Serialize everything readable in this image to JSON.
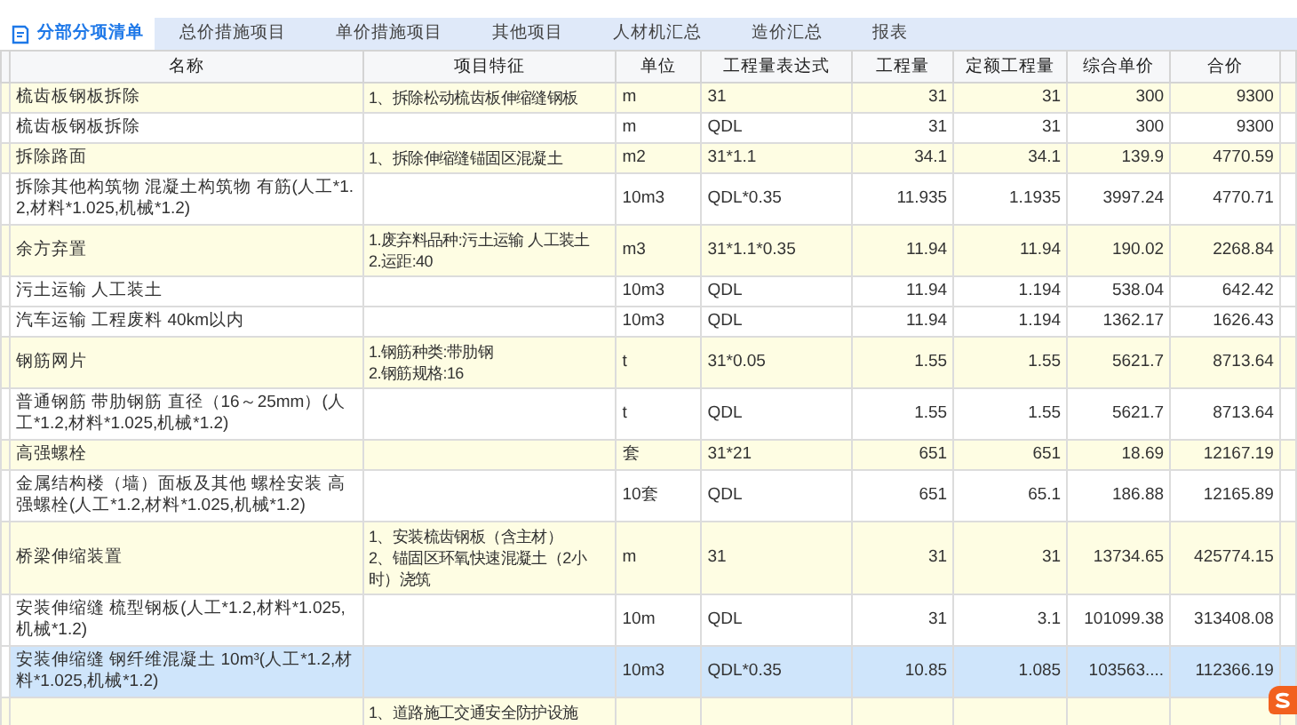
{
  "tabs": [
    {
      "label": "分部分项清单",
      "selected": true
    },
    {
      "label": "总价措施项目",
      "selected": false
    },
    {
      "label": "单价措施项目",
      "selected": false
    },
    {
      "label": "其他项目",
      "selected": false
    },
    {
      "label": "人材机汇总",
      "selected": false
    },
    {
      "label": "造价汇总",
      "selected": false
    },
    {
      "label": "报表",
      "selected": false
    }
  ],
  "table": {
    "columns": [
      "名称",
      "项目特征",
      "单位",
      "工程量表达式",
      "工程量",
      "定额工程量",
      "综合单价",
      "合价"
    ],
    "rows": [
      {
        "kind": "bill",
        "selected": false,
        "cells": [
          "梳齿板钢板拆除",
          "1、拆除松动梳齿板伸缩缝钢板",
          "m",
          "31",
          "31",
          "31",
          "300",
          "9300"
        ]
      },
      {
        "kind": "quota",
        "selected": false,
        "cells": [
          "梳齿板钢板拆除",
          "",
          "m",
          "QDL",
          "31",
          "31",
          "300",
          "9300"
        ]
      },
      {
        "kind": "bill",
        "selected": false,
        "cells": [
          "拆除路面",
          "1、拆除伸缩缝锚固区混凝土",
          "m2",
          "31*1.1",
          "34.1",
          "34.1",
          "139.9",
          "4770.59"
        ]
      },
      {
        "kind": "quota",
        "selected": false,
        "cells": [
          "拆除其他构筑物 混凝土构筑物 有筋(人工*1.2,材料*1.025,机械*1.2)",
          "",
          "10m3",
          "QDL*0.35",
          "11.935",
          "1.1935",
          "3997.24",
          "4770.71"
        ]
      },
      {
        "kind": "bill",
        "selected": false,
        "cells": [
          "余方弃置",
          "1.废弃料品种:污土运输 人工装土\n2.运距:40",
          "m3",
          "31*1.1*0.35",
          "11.94",
          "11.94",
          "190.02",
          "2268.84"
        ]
      },
      {
        "kind": "quota",
        "selected": false,
        "cells": [
          "污土运输 人工装土",
          "",
          "10m3",
          "QDL",
          "11.94",
          "1.194",
          "538.04",
          "642.42"
        ]
      },
      {
        "kind": "quota",
        "selected": false,
        "cells": [
          "汽车运输 工程废料 40km以内",
          "",
          "10m3",
          "QDL",
          "11.94",
          "1.194",
          "1362.17",
          "1626.43"
        ]
      },
      {
        "kind": "bill",
        "selected": false,
        "cells": [
          "钢筋网片",
          "1.钢筋种类:带肋钢\n2.钢筋规格:16",
          "t",
          "31*0.05",
          "1.55",
          "1.55",
          "5621.7",
          "8713.64"
        ]
      },
      {
        "kind": "quota",
        "selected": false,
        "cells": [
          "普通钢筋 带肋钢筋 直径（16～25mm）(人工*1.2,材料*1.025,机械*1.2)",
          "",
          "t",
          "QDL",
          "1.55",
          "1.55",
          "5621.7",
          "8713.64"
        ]
      },
      {
        "kind": "bill",
        "selected": false,
        "cells": [
          "高强螺栓",
          "",
          "套",
          "31*21",
          "651",
          "651",
          "18.69",
          "12167.19"
        ]
      },
      {
        "kind": "quota",
        "selected": false,
        "cells": [
          "金属结构楼（墙）面板及其他 螺栓安装 高强螺栓(人工*1.2,材料*1.025,机械*1.2)",
          "",
          "10套",
          "QDL",
          "651",
          "65.1",
          "186.88",
          "12165.89"
        ]
      },
      {
        "kind": "bill",
        "selected": false,
        "cells": [
          "桥梁伸缩装置",
          "1、安装梳齿钢板（含主材）\n2、锚固区环氧快速混凝土（2小时）浇筑",
          "m",
          "31",
          "31",
          "31",
          "13734.65",
          "425774.15"
        ]
      },
      {
        "kind": "quota",
        "selected": false,
        "cells": [
          "安装伸缩缝 梳型钢板(人工*1.2,材料*1.025,机械*1.2)",
          "",
          "10m",
          "QDL",
          "31",
          "3.1",
          "101099.38",
          "313408.08"
        ]
      },
      {
        "kind": "quota",
        "selected": true,
        "cells": [
          "安装伸缩缝 钢纤维混凝土 10m³(人工*1.2,材料*1.025,机械*1.2)",
          "",
          "10m3",
          "QDL*0.35",
          "10.85",
          "1.085",
          "103563....",
          "112366.19"
        ]
      },
      {
        "kind": "bill",
        "selected": false,
        "cells": [
          "",
          "1、道路施工交通安全防护设施",
          "",
          "",
          "",
          "",
          "",
          ""
        ]
      }
    ]
  }
}
